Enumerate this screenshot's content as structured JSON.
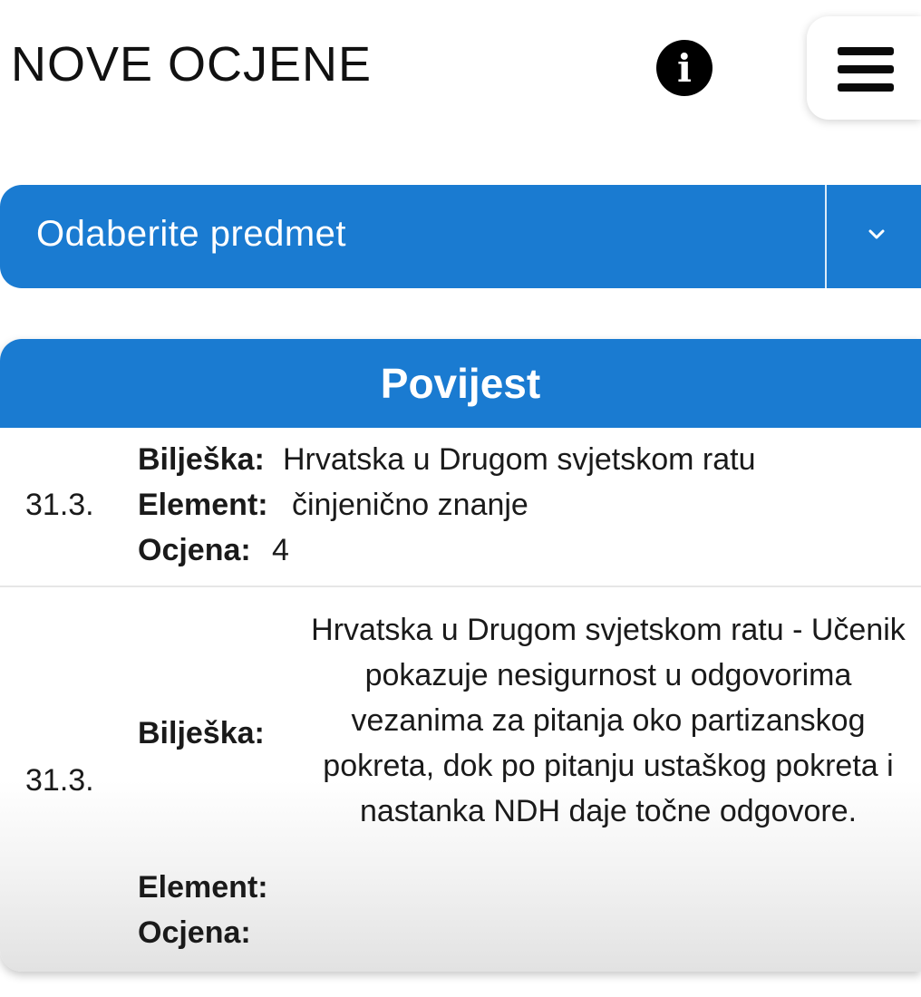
{
  "header": {
    "title": "NOVE OCJENE",
    "info_icon": "info-icon",
    "menu_icon": "hamburger-menu-icon"
  },
  "subject_select": {
    "placeholder": "Odaberite predmet",
    "icon": "chevron-down-icon",
    "color": "#1a7bd1"
  },
  "card": {
    "title": "Povijest",
    "entries": [
      {
        "date": "31.3.",
        "note_label": "Bilješka:",
        "note": "Hrvatska u Drugom svjetskom ratu",
        "element_label": "Element:",
        "element": "činjenično znanje",
        "grade_label": "Ocjena:",
        "grade": "4"
      },
      {
        "date": "31.3.",
        "note_label": "Bilješka:",
        "note": "Hrvatska u Drugom svjetskom ratu - Učenik pokazuje nesigurnost u odgovorima vezanima za pitanja oko partizanskog pokreta, dok po pitanju ustaškog pokreta i nastanka NDH daje točne odgovore.",
        "element_label": "Element:",
        "element": "",
        "grade_label": "Ocjena:",
        "grade": ""
      }
    ]
  }
}
